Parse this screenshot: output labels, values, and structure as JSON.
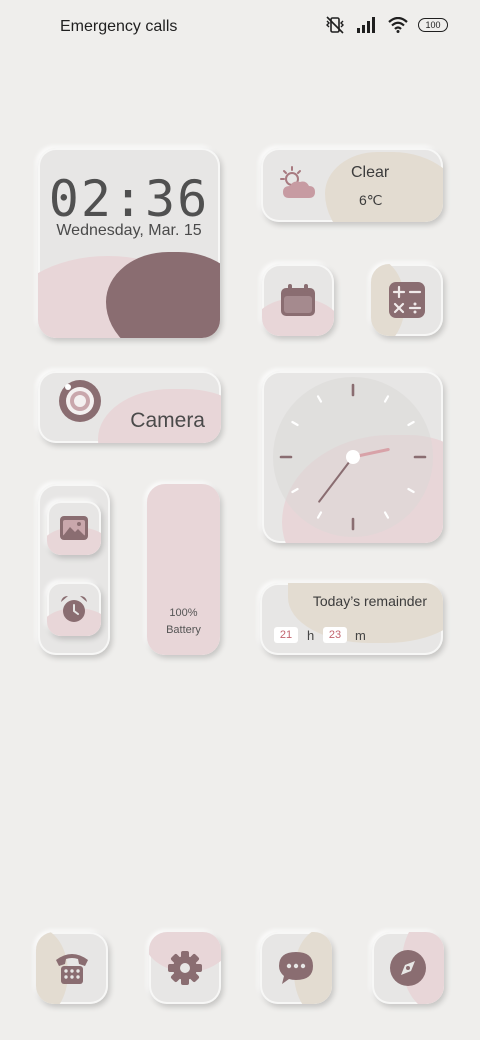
{
  "status_bar": {
    "text": "Emergency calls only",
    "battery": "100",
    "icons": [
      "vibrate-icon",
      "signal-icon",
      "wifi-icon",
      "battery-icon"
    ]
  },
  "clock_widget": {
    "time": "02:36",
    "date": "Wednesday, Mar. 15"
  },
  "weather_widget": {
    "condition": "Clear",
    "temperature": "6℃",
    "icon": "partly-sunny-icon"
  },
  "camera_widget": {
    "label": "Camera",
    "icon": "camera-lens-icon"
  },
  "battery_widget": {
    "percent": "100%",
    "label": "Battery",
    "level": 1.0
  },
  "analog_clock": {
    "hour": 2,
    "minute": 36,
    "second": 12
  },
  "remainder_widget": {
    "title": "Today’s remainder",
    "hours": "21",
    "hours_unit": "h",
    "minutes": "23",
    "minutes_unit": "m"
  },
  "dock": [
    "phone-icon",
    "settings-icon",
    "messages-icon",
    "browser-icon"
  ],
  "colors": {
    "background": "#efeeec",
    "card": "#e7e6e5",
    "rose": "#e8d6d8",
    "mauve": "#8a6d71",
    "beige": "#e3dcd1",
    "accent_red": "#c2636d"
  }
}
